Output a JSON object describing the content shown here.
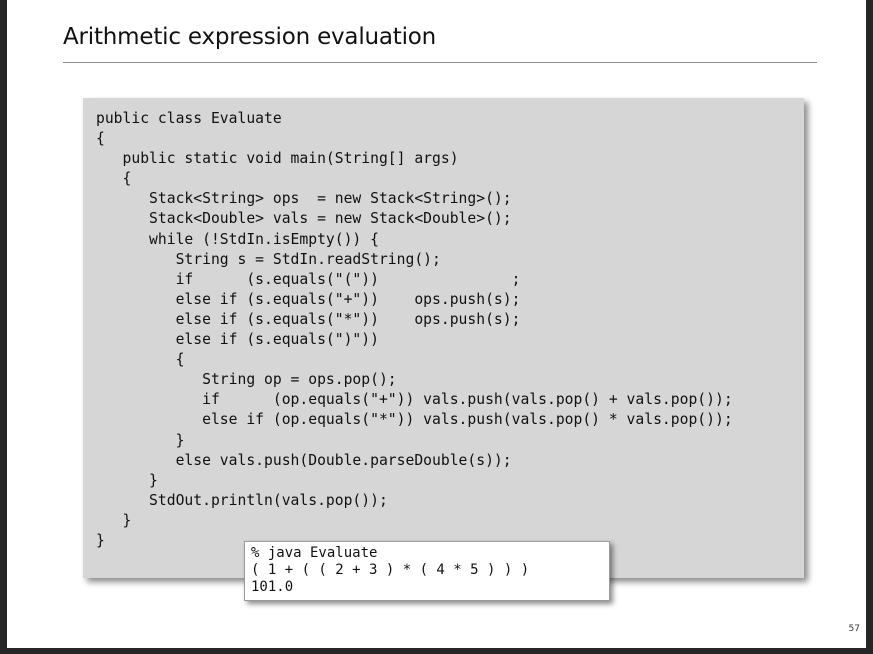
{
  "slide": {
    "title": "Arithmetic expression evaluation",
    "page_number": "57"
  },
  "code": {
    "lines": [
      "public class Evaluate",
      "{",
      "   public static void main(String[] args)",
      "   {",
      "      Stack<String> ops  = new Stack<String>();",
      "      Stack<Double> vals = new Stack<Double>();",
      "      while (!StdIn.isEmpty()) {",
      "         String s = StdIn.readString();",
      "         if      (s.equals(\"(\"))               ;",
      "         else if (s.equals(\"+\"))    ops.push(s);",
      "         else if (s.equals(\"*\"))    ops.push(s);",
      "         else if (s.equals(\")\"))",
      "         {",
      "            String op = ops.pop();",
      "            if      (op.equals(\"+\")) vals.push(vals.pop() + vals.pop());",
      "            else if (op.equals(\"*\")) vals.push(vals.pop() * vals.pop());",
      "         }",
      "         else vals.push(Double.parseDouble(s));",
      "      }",
      "      StdOut.println(vals.pop());",
      "   }",
      "}"
    ]
  },
  "console": {
    "lines": [
      "% java Evaluate",
      "( 1 + ( ( 2 + 3 ) * ( 4 * 5 ) ) )",
      "101.0"
    ]
  }
}
